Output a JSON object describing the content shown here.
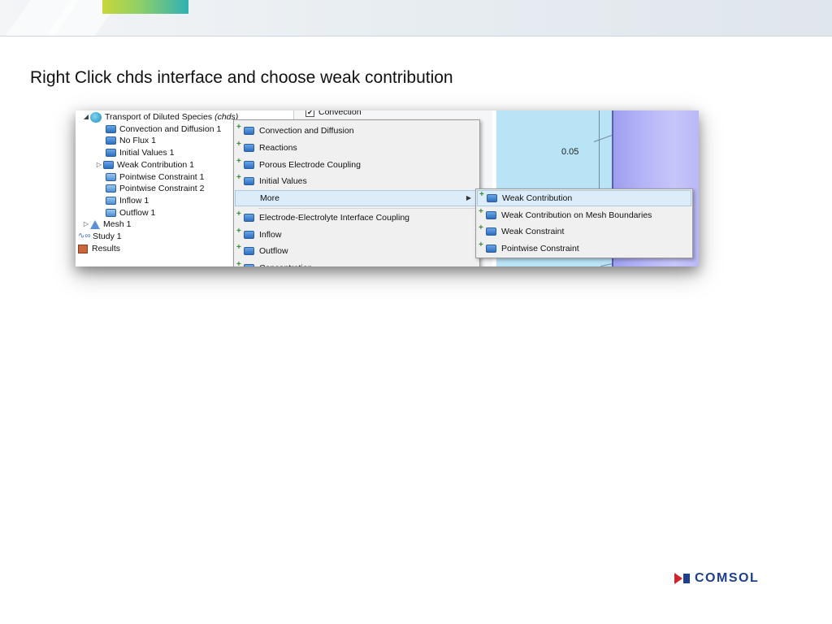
{
  "slide": {
    "title": "Right Click chds interface and choose weak contribution",
    "brand": "COMSOL"
  },
  "tree": {
    "items": [
      {
        "label": "Transport of Diluted Species",
        "suffix": "(chds)"
      },
      {
        "label": "Convection and Diffusion 1"
      },
      {
        "label": "No Flux 1"
      },
      {
        "label": "Initial Values 1"
      },
      {
        "label": "Weak Contribution 1"
      },
      {
        "label": "Pointwise Constraint 1"
      },
      {
        "label": "Pointwise Constraint 2"
      },
      {
        "label": "Inflow 1"
      },
      {
        "label": "Outflow 1"
      },
      {
        "label": "Mesh 1"
      },
      {
        "label": "Study 1"
      },
      {
        "label": "Results"
      }
    ]
  },
  "settings": {
    "convection_label": "Convection",
    "convection_checked": true
  },
  "graphics": {
    "value_label": "0.05"
  },
  "context_menu": {
    "items": [
      {
        "label": "Convection and Diffusion"
      },
      {
        "label": "Reactions"
      },
      {
        "label": "Porous Electrode Coupling"
      },
      {
        "label": "Initial Values"
      },
      {
        "label": "More"
      },
      {
        "label": "Electrode-Electrolyte Interface Coupling"
      },
      {
        "label": "Inflow"
      },
      {
        "label": "Outflow"
      },
      {
        "label": "Concentration"
      }
    ]
  },
  "submenu": {
    "items": [
      {
        "label": "Weak Contribution"
      },
      {
        "label": "Weak Contribution on Mesh Boundaries"
      },
      {
        "label": "Weak Constraint"
      },
      {
        "label": "Pointwise Constraint"
      }
    ]
  },
  "colors": {
    "menu_highlight": "#dcecf8",
    "graphics_bg": "#b9e4f6",
    "geometry": "#b2b2f7",
    "brand_red": "#d4202a",
    "brand_blue": "#1d3f8c"
  }
}
